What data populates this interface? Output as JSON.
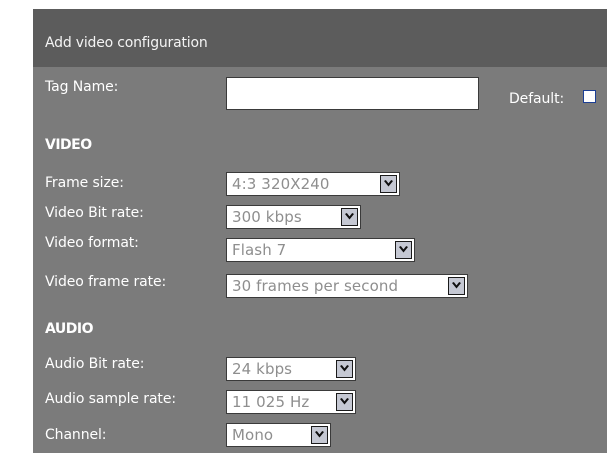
{
  "header": {
    "title": "Add video configuration"
  },
  "form": {
    "tag_name": {
      "label": "Tag Name:",
      "value": ""
    },
    "default": {
      "label": "Default:",
      "checked": false
    },
    "video": {
      "section_title": "VIDEO",
      "frame_size": {
        "label": "Frame size:",
        "value": "4:3 320X240"
      },
      "bit_rate": {
        "label": "Video Bit rate:",
        "value": "300 kbps"
      },
      "format": {
        "label": "Video format:",
        "value": "Flash 7"
      },
      "frame_rate": {
        "label": "Video frame rate:",
        "value": "30 frames per second"
      }
    },
    "audio": {
      "section_title": "AUDIO",
      "bit_rate": {
        "label": "Audio Bit rate:",
        "value": "24 kbps"
      },
      "sample_rate": {
        "label": "Audio sample rate:",
        "value": "11 025 Hz"
      },
      "channel": {
        "label": "Channel:",
        "value": "Mono"
      }
    }
  },
  "icons": {
    "dropdown": "chevron-down-icon"
  },
  "colors": {
    "panel": "#7b7b7b",
    "header": "#5c5c5c",
    "dropdown_arrow_bg": "#c5c8d3",
    "checkbox_border": "#1c3f95"
  }
}
